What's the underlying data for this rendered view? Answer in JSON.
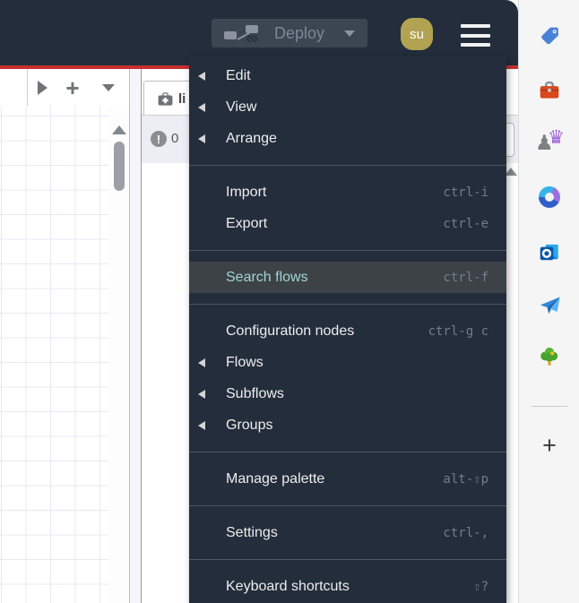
{
  "colors": {
    "header_bg": "#232d3b",
    "accent_red": "#c5302e",
    "menu_highlight_text": "#9fd6d2",
    "menu_highlight_bg": "#3d4247",
    "avatar_bg": "#b1a351"
  },
  "header": {
    "deploy_label": "Deploy",
    "avatar_initials": "su"
  },
  "menu": {
    "items": [
      {
        "label": "Edit",
        "shortcut": "",
        "submenu": true
      },
      {
        "label": "View",
        "shortcut": "",
        "submenu": true
      },
      {
        "label": "Arrange",
        "shortcut": "",
        "submenu": true
      },
      {
        "separator": true
      },
      {
        "label": "Import",
        "shortcut": "ctrl-i"
      },
      {
        "label": "Export",
        "shortcut": "ctrl-e"
      },
      {
        "separator": true
      },
      {
        "label": "Search flows",
        "shortcut": "ctrl-f",
        "highlighted": true
      },
      {
        "separator": true
      },
      {
        "label": "Configuration nodes",
        "shortcut": "ctrl-g c"
      },
      {
        "label": "Flows",
        "shortcut": "",
        "submenu": true
      },
      {
        "label": "Subflows",
        "shortcut": "",
        "submenu": true
      },
      {
        "label": "Groups",
        "shortcut": "",
        "submenu": true
      },
      {
        "separator": true
      },
      {
        "label": "Manage palette",
        "shortcut": "alt-⇧p"
      },
      {
        "separator": true
      },
      {
        "label": "Settings",
        "shortcut": "ctrl-,"
      },
      {
        "separator": true
      },
      {
        "label": "Keyboard shortcuts",
        "shortcut": "⇧?"
      }
    ]
  },
  "panel": {
    "tab_label": "li",
    "warning_count": "0",
    "warning_glyph": "!"
  },
  "edge_sidebar": {
    "icons": [
      "tag",
      "toolbox",
      "chess-pieces",
      "microsoft-loop",
      "outlook",
      "paper-plane",
      "tree",
      "add-new"
    ],
    "chess_pawn_glyph": "♟",
    "chess_rook_glyph": "♛",
    "plus_glyph": "+"
  },
  "workspace": {
    "plus_glyph": "+"
  }
}
